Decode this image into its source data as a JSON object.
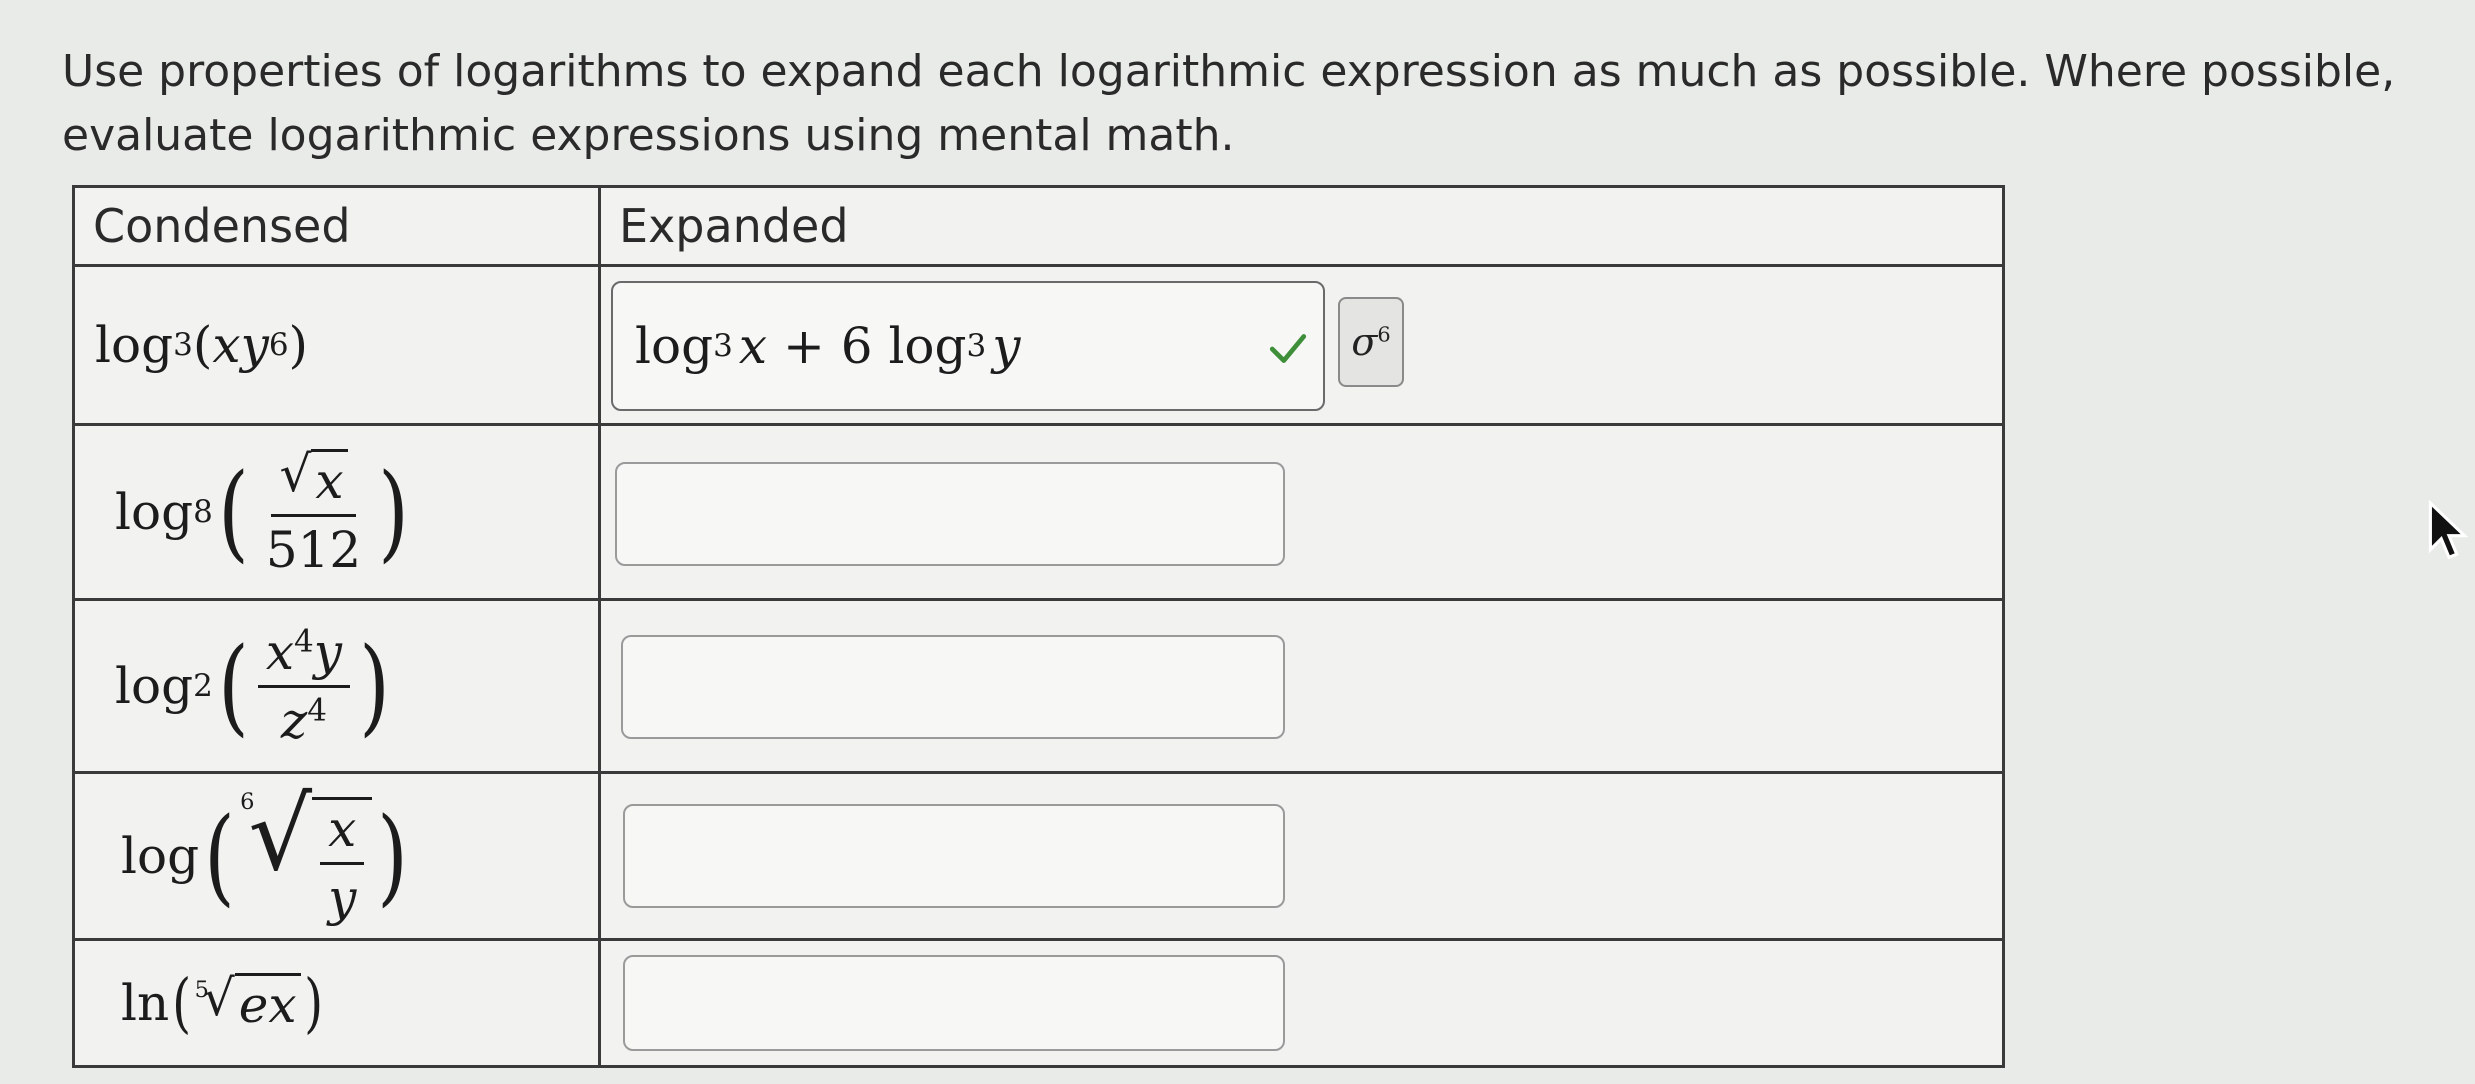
{
  "instructions": "Use properties of logarithms to expand each logarithmic expression as much as possible. Where possible, evaluate logarithmic expressions using mental math.",
  "table": {
    "headers": {
      "condensed": "Condensed",
      "expanded": "Expanded"
    },
    "rows": [
      {
        "log": "log",
        "base": "3",
        "lparen": "(",
        "rparen": ")",
        "x": "x",
        "y": "y",
        "exp": "6",
        "answer": {
          "log1": "log",
          "base1": "3",
          "var1": "x",
          "plus": " + 6 ",
          "log2": "log",
          "base2": "3",
          "var2": "y"
        },
        "status_icon": "check-icon",
        "tool_icon": "sigma-superscript-icon",
        "tool_glyph": "σ",
        "tool_sup": "6"
      },
      {
        "log": "log",
        "base": "8",
        "num_var": "x",
        "den": "512",
        "answer": ""
      },
      {
        "log": "log",
        "base": "2",
        "num_var": "x",
        "num_exp": "4",
        "num_var2": "y",
        "den_var": "z",
        "den_exp": "4",
        "answer": ""
      },
      {
        "log": "log",
        "index": "6",
        "num_var": "x",
        "den_var": "y",
        "answer": ""
      },
      {
        "log": "ln",
        "index": "5",
        "radicand": "ex",
        "answer": ""
      }
    ]
  },
  "colors": {
    "check": "#3f8f3a",
    "border": "#3a3a3a",
    "input_border": "#9a9a9a"
  },
  "cursor_icon": "arrow-cursor-icon"
}
